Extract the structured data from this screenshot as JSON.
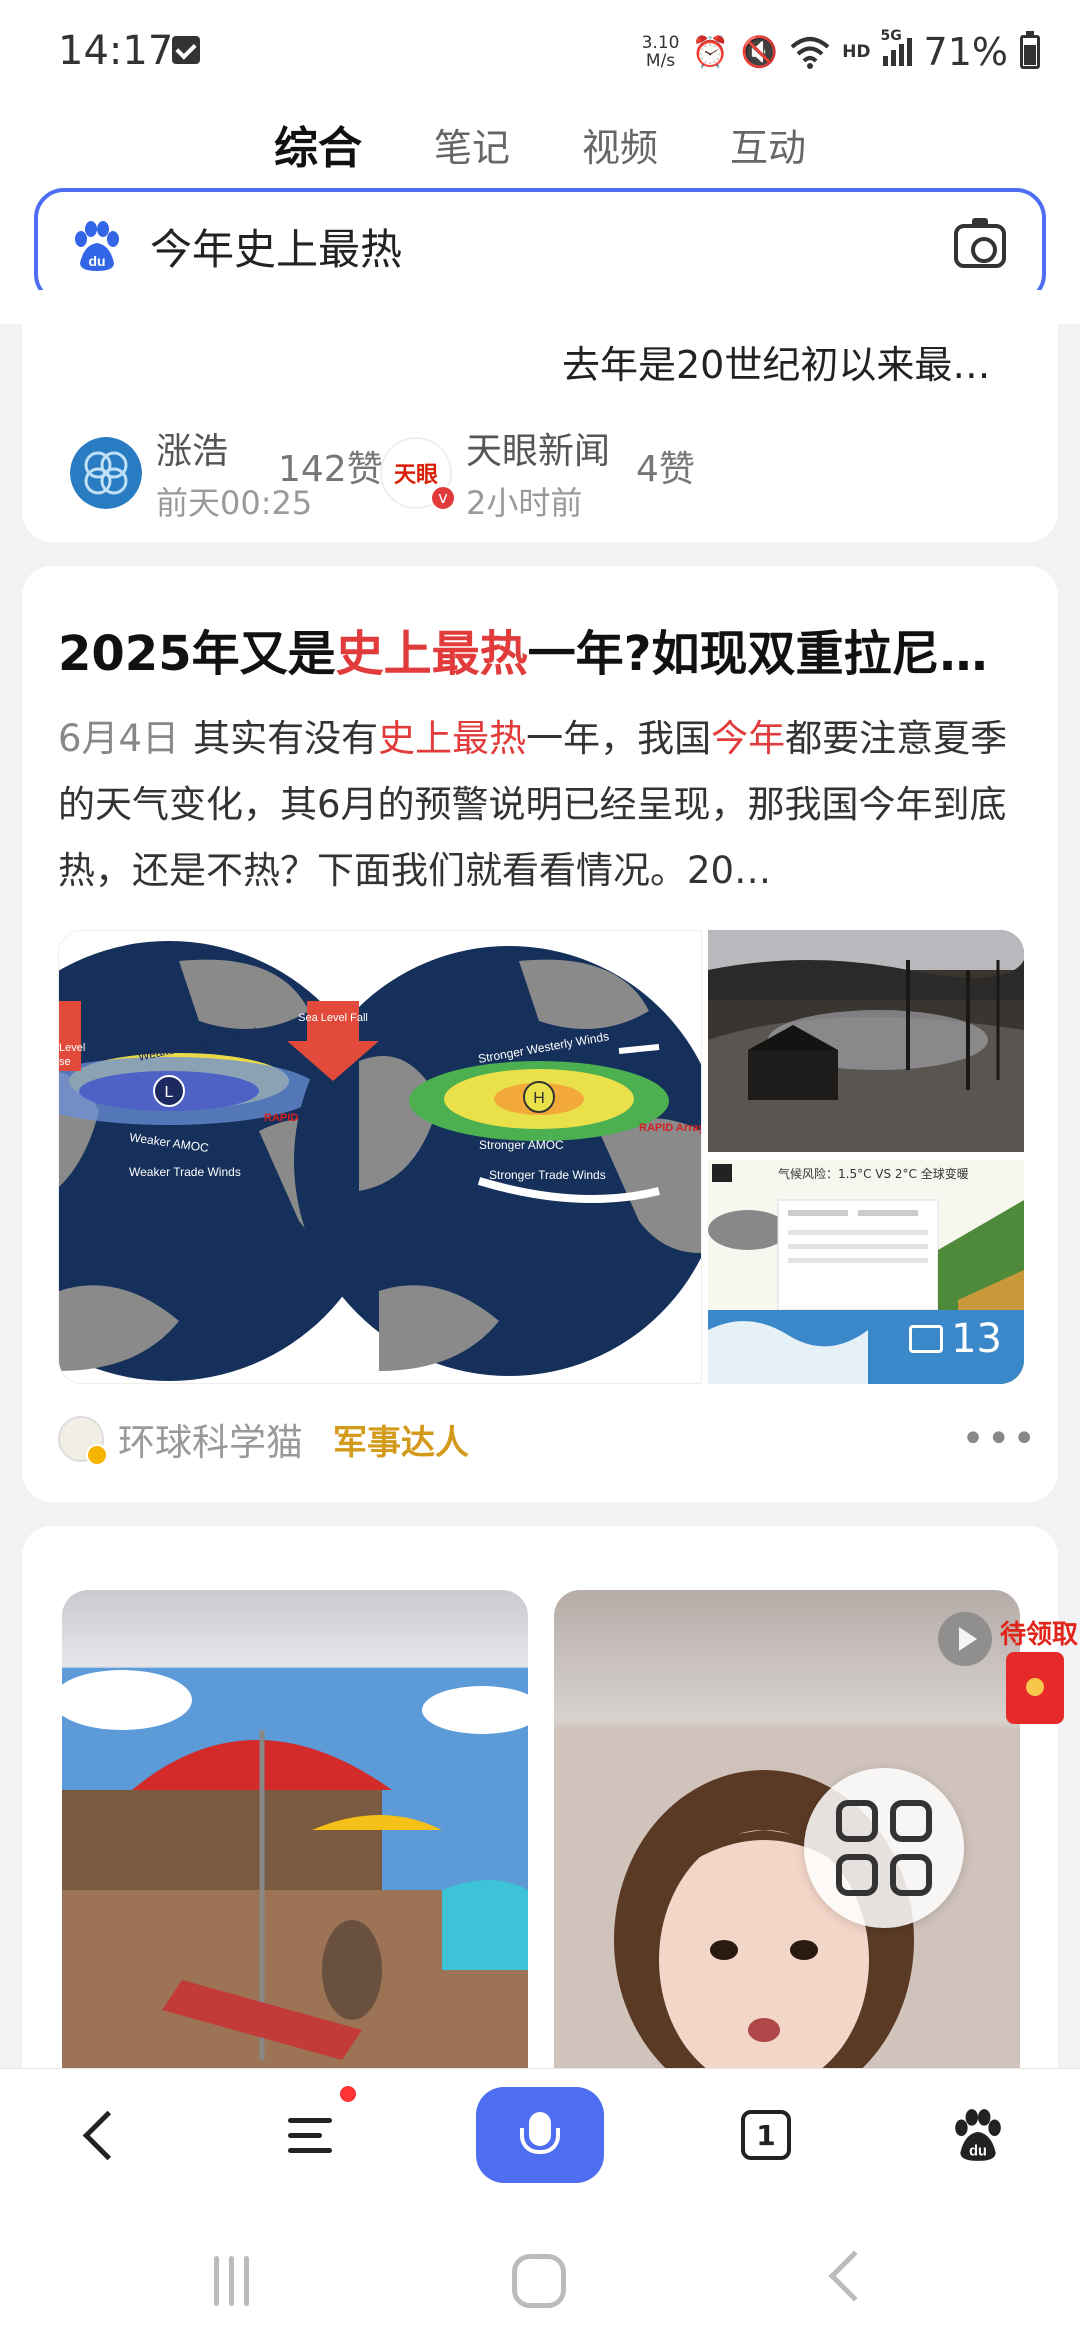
{
  "status_bar": {
    "time": "14:17",
    "net_speed_value": "3.10",
    "net_speed_unit": "M/s",
    "hd": "HD",
    "signal": "5G",
    "battery": "71%"
  },
  "tabs": [
    "综合",
    "笔记",
    "视频",
    "互动"
  ],
  "search": {
    "query": "今年史上最热"
  },
  "card1": {
    "title": "去年是20世纪初以来最…",
    "left_author": {
      "name": "涨浩",
      "time": "前天00:25",
      "likes": "142赞"
    },
    "right_author": {
      "name": "天眼新闻",
      "time": "2小时前",
      "likes": "4赞",
      "avatar_text": "天眼"
    }
  },
  "card2": {
    "title_pre": "2025年又是",
    "title_highlight": "史上最热",
    "title_post": "一年?如现双重拉尼…",
    "date": "6月4日",
    "desc_1": "其实有没有",
    "desc_hl1": "史上最热",
    "desc_2": "一年，我国",
    "desc_hl2": "今年",
    "desc_3": "都要注意夏季的天气变化，其6月的预警说明已经呈现，那我国今年到底热，还是不热？下面我们就看看情况。20…",
    "image_count": "13",
    "map_labels": {
      "weak_westerly": "Weaker Westerly Winds",
      "weak_amoc": "Weaker AMOC",
      "weak_trade": "Weaker Trade Winds",
      "rapid": "RAPID Array",
      "sea_level_fall": "Sea Level Fall",
      "strong_westerly": "Stronger Westerly Winds",
      "strong_amoc": "Stronger AMOC",
      "strong_trade": "Stronger Trade Winds",
      "L": "L",
      "H": "H",
      "level_rise_1": "Level",
      "level_rise_2": "se"
    },
    "info_title": "气候风险：1.5°C VS 2°C 全球变暖",
    "source": "环球科学猫",
    "tag": "军事达人"
  },
  "card3": {
    "reward_label": "待领取"
  },
  "bottom_nav": {
    "tabs_count": "1"
  }
}
